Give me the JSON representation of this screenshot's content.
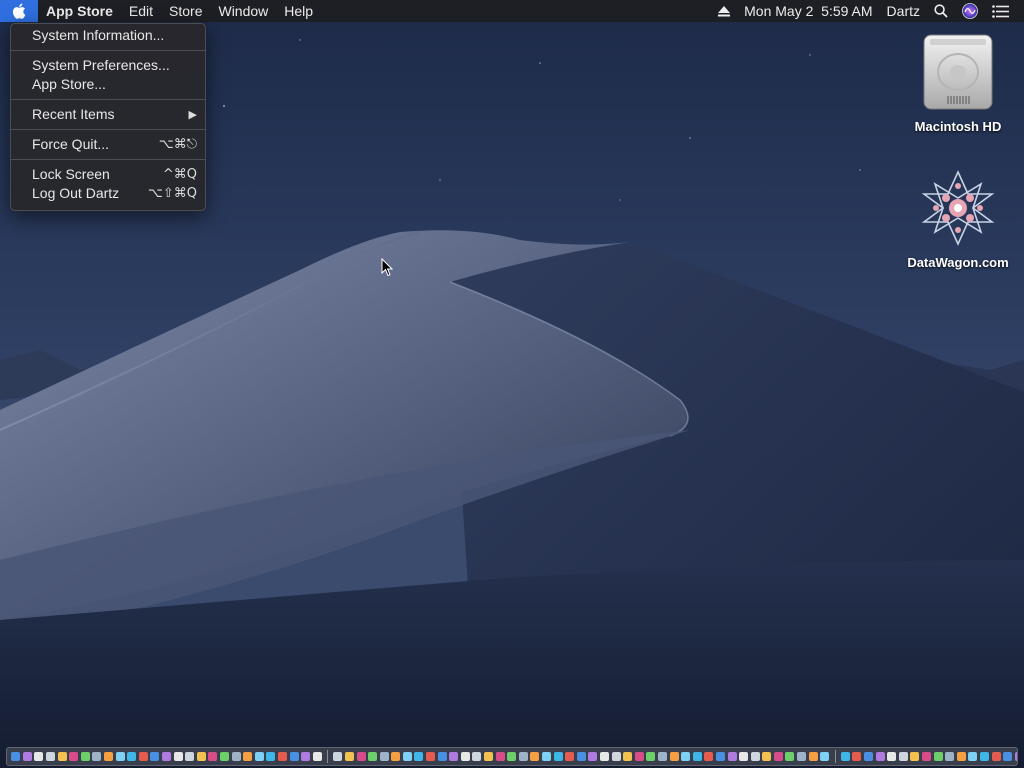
{
  "menubar": {
    "app_name": "App Store",
    "menus": [
      "Edit",
      "Store",
      "Window",
      "Help"
    ],
    "date": "Mon May 2",
    "time": "5:59 AM",
    "user": "Dartz",
    "icons": [
      "apple-icon",
      "eject-icon",
      "search-icon",
      "siri-icon",
      "notification-center-icon"
    ]
  },
  "apple_menu": {
    "items": [
      {
        "label": "System Information...",
        "shortcut": ""
      },
      {
        "label": "System Preferences...",
        "shortcut": ""
      },
      {
        "label": "App Store...",
        "shortcut": ""
      },
      {
        "label": "Recent Items",
        "shortcut": "▶"
      },
      {
        "label": "Force Quit...",
        "shortcut": "⌥⌘⎋"
      },
      {
        "label": "Lock Screen",
        "shortcut": "^⌘Q"
      },
      {
        "label": "Log Out Dartz",
        "shortcut": "⌥⇧⌘Q"
      }
    ]
  },
  "desktop": {
    "icons": [
      {
        "label": "Macintosh HD",
        "icon": "hard-drive-icon"
      },
      {
        "label": "DataWagon.com",
        "icon": "datawagon-icon"
      }
    ]
  },
  "colors": {
    "menubar_bg": "#1e1e22",
    "apple_highlight": "#2f6fe0",
    "menu_bg": "#28282c",
    "sky_top": "#233253",
    "sky_bottom": "#3b4f74",
    "dune_light": "#8a96b1"
  }
}
